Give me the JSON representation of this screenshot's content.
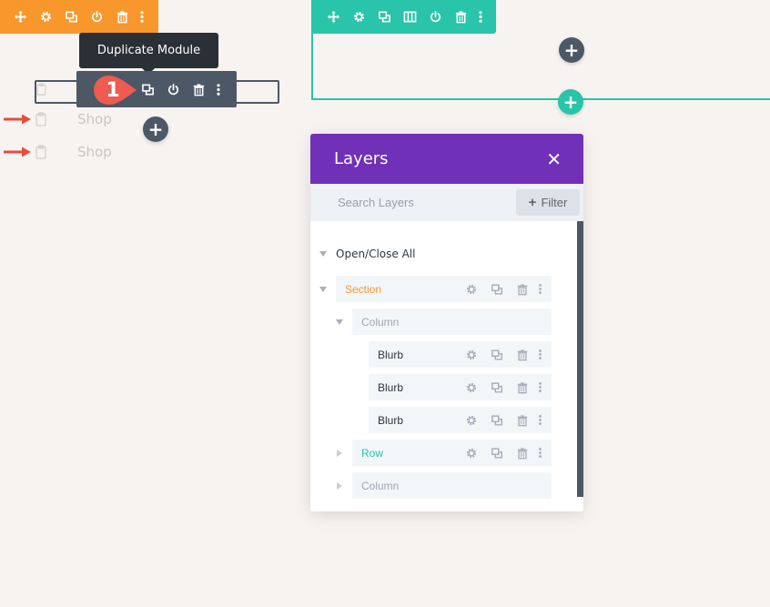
{
  "tooltip": {
    "text": "Duplicate Module"
  },
  "step_badge": {
    "number": "1",
    "color": "#ef5a51"
  },
  "shop_items": [
    {
      "label": "Shop"
    },
    {
      "label": "Shop"
    }
  ],
  "layers": {
    "title": "Layers",
    "search_placeholder": "Search Layers",
    "filter_label": "Filter",
    "open_close_label": "Open/Close All",
    "tree": [
      {
        "label": "Section",
        "type": "section",
        "color": "#f8972c"
      },
      {
        "label": "Column",
        "type": "column",
        "color": "#a0a7b0"
      },
      {
        "label": "Blurb",
        "type": "module",
        "color": "#2e3640"
      },
      {
        "label": "Blurb",
        "type": "module",
        "color": "#2e3640"
      },
      {
        "label": "Blurb",
        "type": "module",
        "color": "#2e3640"
      },
      {
        "label": "Row",
        "type": "row",
        "color": "#29c4a9"
      },
      {
        "label": "Column",
        "type": "column",
        "color": "#a0a7b0"
      }
    ]
  },
  "colors": {
    "section": "#f8972c",
    "row": "#29c4a9",
    "module": "#4c5866",
    "layers_header": "#7030b8",
    "arrow": "#e74c3c"
  }
}
